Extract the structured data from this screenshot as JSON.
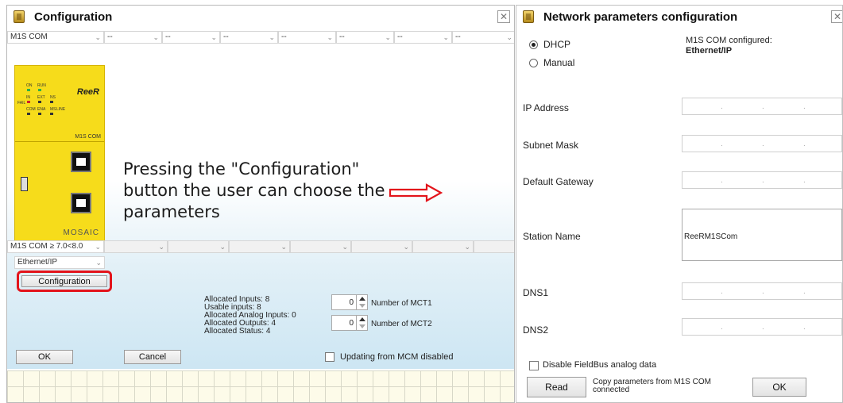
{
  "config_window": {
    "title": "Configuration",
    "module_select": "M1S COM",
    "empty_slot": "--",
    "module_model": "M1S COM",
    "module_brand": "ReeR",
    "module_series": "MOSAIC",
    "leds": [
      "ON",
      "RUN",
      "IN",
      "EXT",
      "NS",
      "FAIL",
      "COM",
      "ENA",
      "MS",
      "LINE"
    ],
    "version_select": "M1S COM ≥ 7.0<8.0",
    "protocol_select": "Ethernet/IP",
    "configuration_button": "Configuration",
    "annotation_text": "Pressing the \"Configuration\" button the user can choose the parameters",
    "allocation": {
      "allocated_inputs": "Allocated Inputs: 8",
      "usable_inputs": "Usable inputs: 8",
      "allocated_analog_inputs": "Allocated Analog Inputs: 0",
      "allocated_outputs": "Allocated Outputs: 4",
      "allocated_status": "Allocated Status: 4"
    },
    "mct1": {
      "value": "0",
      "label": "Number of MCT1"
    },
    "mct2": {
      "value": "0",
      "label": "Number of MCT2"
    },
    "ok_label": "OK",
    "cancel_label": "Cancel",
    "updating_checkbox_label": "Updating from MCM disabled"
  },
  "network_window": {
    "title": "Network parameters configuration",
    "dhcp_label": "DHCP",
    "manual_label": "Manual",
    "selected_mode": "DHCP",
    "configured_caption": "M1S COM configured:",
    "configured_value": "Ethernet/IP",
    "ip_address_label": "IP Address",
    "subnet_mask_label": "Subnet Mask",
    "default_gateway_label": "Default Gateway",
    "station_name_label": "Station Name",
    "station_name_value": "ReeRM1SCom",
    "dns1_label": "DNS1",
    "dns2_label": "DNS2",
    "ip_separator": ".",
    "disable_analog_label": "Disable FieldBus analog data",
    "read_label": "Read",
    "copy_hint": "Copy parameters from M1S COM connected",
    "ok_label": "OK"
  },
  "colors": {
    "module_yellow": "#f6dc1b",
    "highlight_red": "#e3141b",
    "background_blue": "#cde6f3"
  }
}
